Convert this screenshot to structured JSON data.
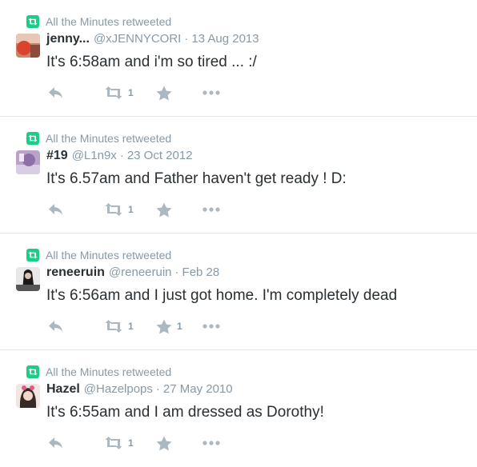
{
  "tweets": [
    {
      "context": "All the Minutes retweeted",
      "fullname": "jenny...",
      "username": "@xJENNYCORI",
      "separator": "·",
      "time": "13 Aug 2013",
      "text": "It's 6:58am and i'm so tired ... :/",
      "retweet_count": "1",
      "favorite_count": ""
    },
    {
      "context": "All the Minutes retweeted",
      "fullname": "#19",
      "username": "@L1n9x",
      "separator": "·",
      "time": "23 Oct 2012",
      "text": "It's 6.57am and Father haven't get ready ! D:",
      "retweet_count": "1",
      "favorite_count": ""
    },
    {
      "context": "All the Minutes retweeted",
      "fullname": "reneeruin",
      "username": "@reneeruin",
      "separator": "·",
      "time": "Feb 28",
      "text": "It's 6:56am and I just got home. I'm completely dead",
      "retweet_count": "1",
      "favorite_count": "1"
    },
    {
      "context": "All the Minutes retweeted",
      "fullname": "Hazel",
      "username": "@Hazelpops",
      "separator": "·",
      "time": "27 May 2010",
      "text": "It's 6:55am and I am dressed as Dorothy!",
      "retweet_count": "1",
      "favorite_count": ""
    }
  ],
  "icons": {
    "retweet_context": "retweet-icon",
    "reply": "reply-icon",
    "retweet": "retweet-icon",
    "favorite": "star-icon",
    "more": "more-icon"
  },
  "colors": {
    "retweet_green": "#19cf86",
    "action_gray": "#aab8c2",
    "meta_gray": "#8899a6",
    "text": "#292f33"
  }
}
